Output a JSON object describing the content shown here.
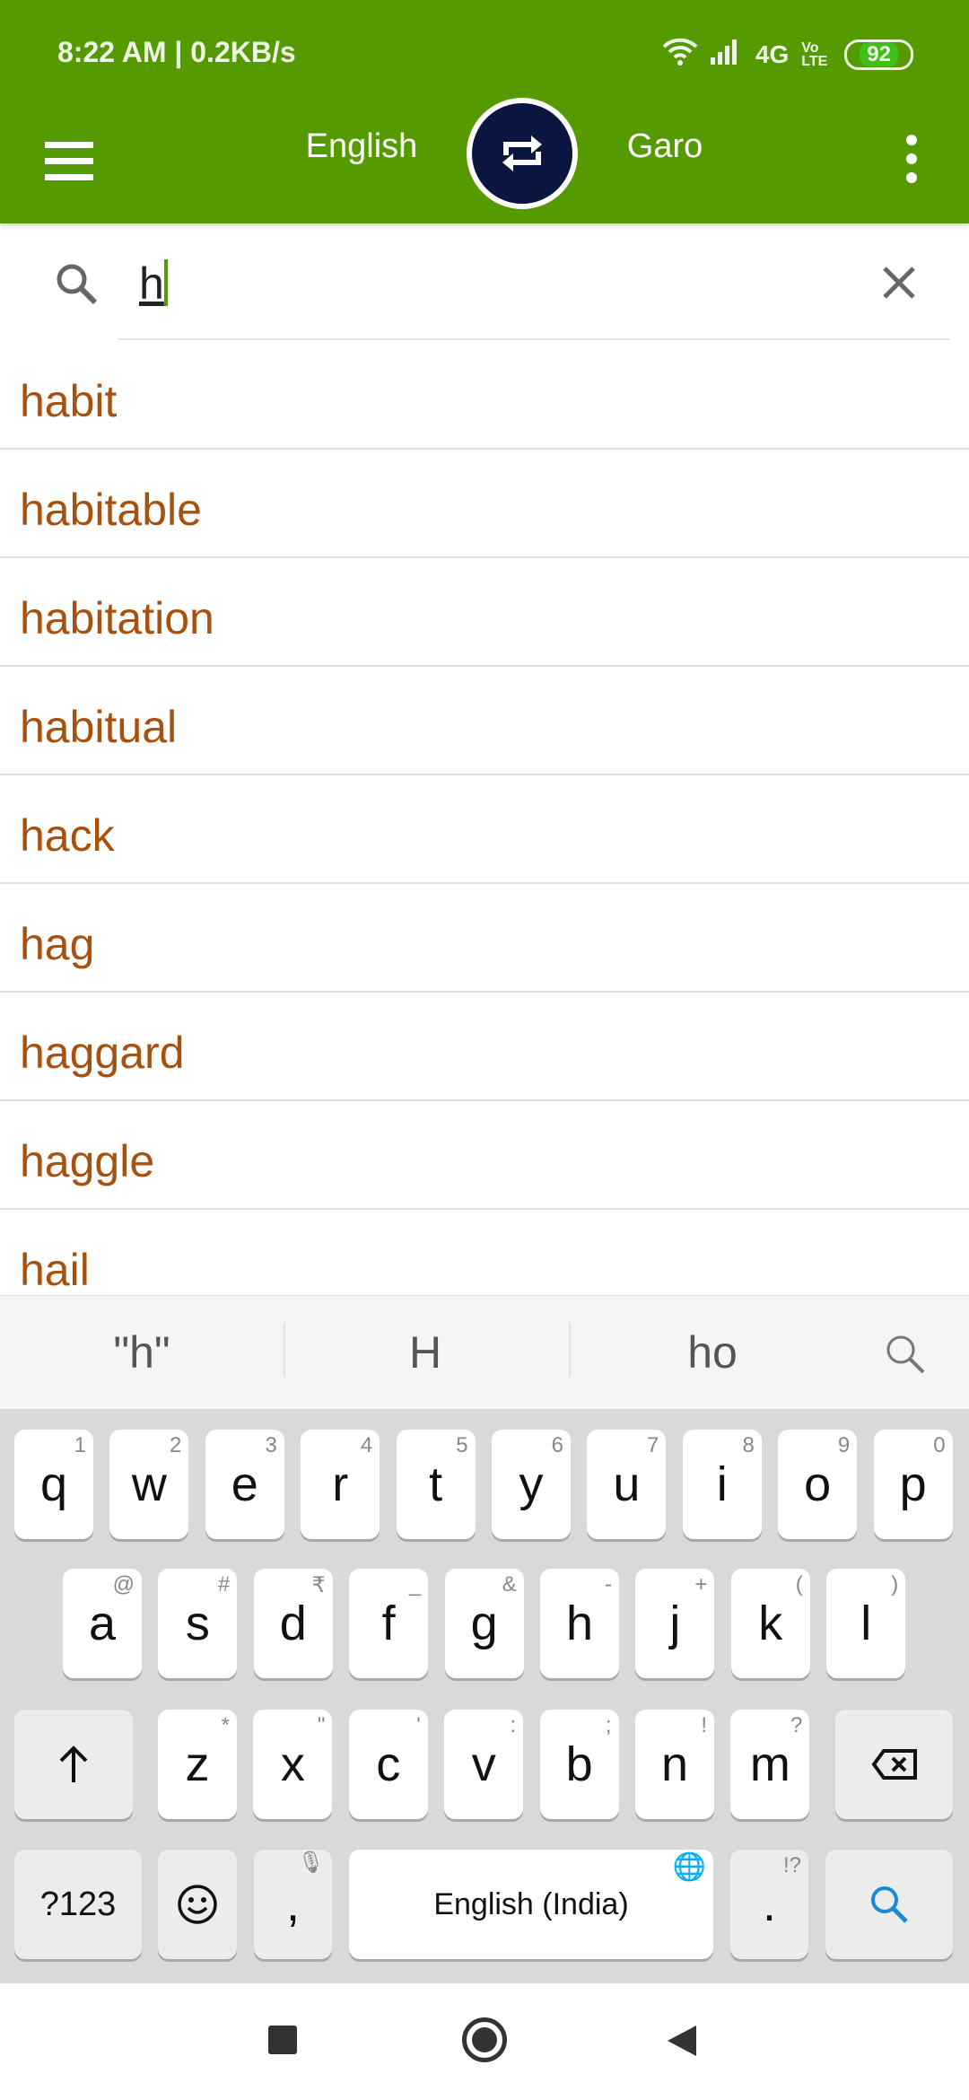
{
  "status": {
    "time": "8:22 AM | 0.2KB/s",
    "network": "4G",
    "volte": "Vo LTE",
    "battery": "92"
  },
  "appbar": {
    "source_lang": "English",
    "target_lang": "Garo"
  },
  "search": {
    "value": "h"
  },
  "results": [
    "habit",
    "habitable",
    "habitation",
    "habitual",
    "hack",
    "hag",
    "haggard",
    "haggle",
    "hail"
  ],
  "suggestions": [
    "\"h\"",
    "H",
    "ho"
  ],
  "keyboard": {
    "row1": [
      [
        "q",
        "1"
      ],
      [
        "w",
        "2"
      ],
      [
        "e",
        "3"
      ],
      [
        "r",
        "4"
      ],
      [
        "t",
        "5"
      ],
      [
        "y",
        "6"
      ],
      [
        "u",
        "7"
      ],
      [
        "i",
        "8"
      ],
      [
        "o",
        "9"
      ],
      [
        "p",
        "0"
      ]
    ],
    "row2": [
      [
        "a",
        "@"
      ],
      [
        "s",
        "#"
      ],
      [
        "d",
        "₹"
      ],
      [
        "f",
        "_"
      ],
      [
        "g",
        "&"
      ],
      [
        "h",
        "-"
      ],
      [
        "j",
        "+"
      ],
      [
        "k",
        "("
      ],
      [
        "l",
        ")"
      ]
    ],
    "row3": [
      [
        "z",
        "*"
      ],
      [
        "x",
        "\""
      ],
      [
        "c",
        "'"
      ],
      [
        "v",
        ":"
      ],
      [
        "b",
        ";"
      ],
      [
        "n",
        "!"
      ],
      [
        "m",
        "?"
      ]
    ],
    "symbols_label": "?123",
    "comma": ",",
    "space_label": "English (India)",
    "period": ".",
    "period_hint": "!?"
  },
  "colors": {
    "brand": "#549a00",
    "swap_button": "#0a1540",
    "result_text": "#a8500e"
  }
}
